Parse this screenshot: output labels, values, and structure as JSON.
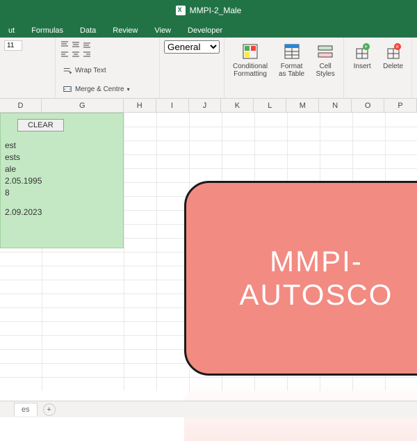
{
  "title": "MMPI-2_Male",
  "tabs": {
    "t0": "ut",
    "t1": "Formulas",
    "t2": "Data",
    "t3": "Review",
    "t4": "View",
    "t5": "Developer"
  },
  "ribbon": {
    "wrap": "Wrap Text",
    "merge": "Merge & Centre",
    "numfmt": "General",
    "cond": "Conditional\nFormatting",
    "fmttable": "Format\nas Table",
    "cellstyles": "Cell\nStyles",
    "insert": "Insert",
    "delete": "Delete",
    "fontsize": "11"
  },
  "cols": [
    "D",
    "G",
    "H",
    "I",
    "J",
    "K",
    "L",
    "M",
    "N",
    "O",
    "P"
  ],
  "panel": {
    "clear": "CLEAR",
    "r1": "est",
    "r2": "ests",
    "r3": "ale",
    "r4": "2.05.1995",
    "r5": "8",
    "r6": "2.09.2023"
  },
  "overlay": {
    "line1": "MMPI-",
    "line2": "AUTOSCO"
  },
  "sheettab": "es"
}
